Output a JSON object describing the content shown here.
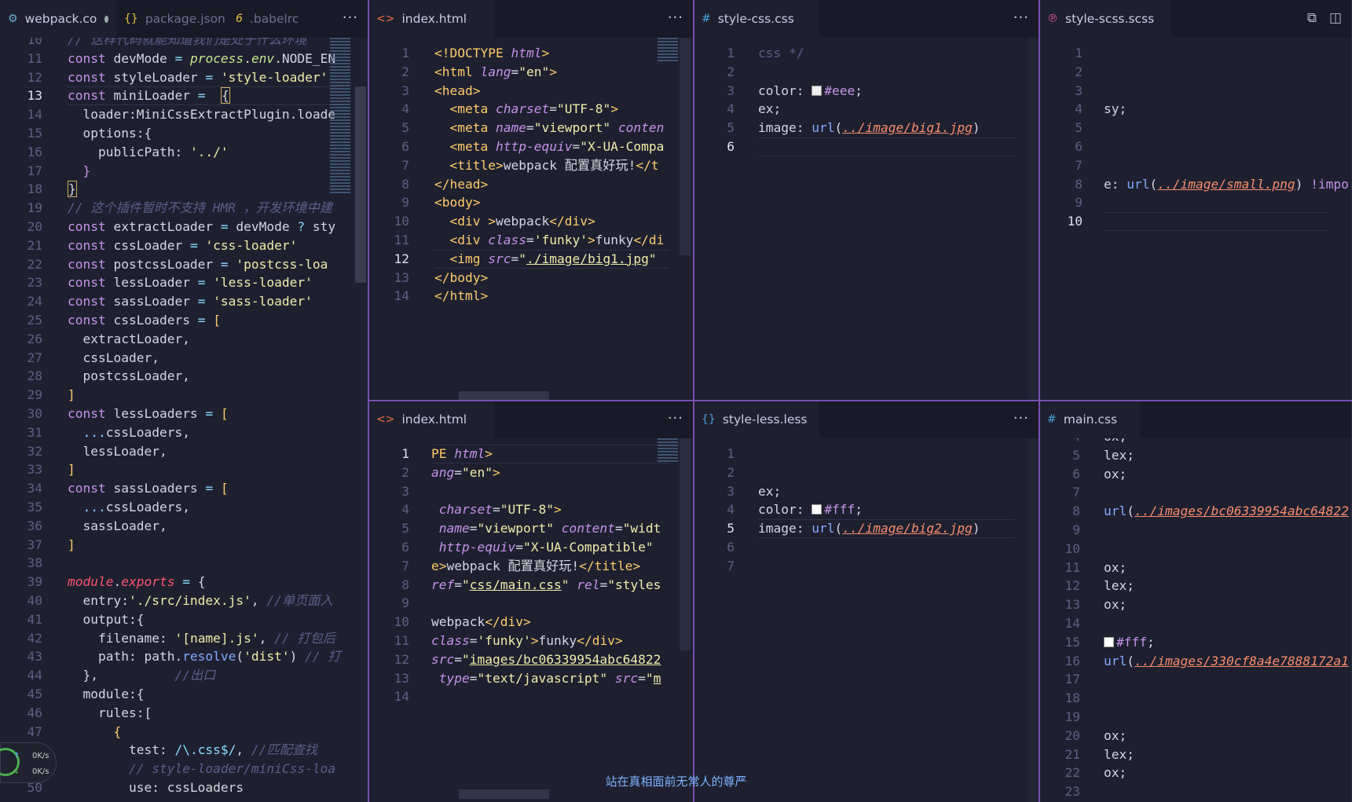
{
  "panes": {
    "webpack": {
      "tabs": [
        {
          "label": "webpack.co",
          "icon": "settings-icon",
          "active": true
        },
        {
          "label": "package.json",
          "icon": "braces-icon"
        },
        {
          "label": ".babelrc",
          "icon": "babel-icon"
        }
      ],
      "more": "···",
      "lines": [
        {
          "n": "10",
          "html": "<span class='c'>// 这样代码就能知道我们是处于什么环境</span>"
        },
        {
          "n": "11",
          "html": "<span class='k'>const</span> devMode <span class='p'>=</span> <span class='i'>process</span>.<span class='i'>env</span>.NODE_EN"
        },
        {
          "n": "12",
          "html": "<span class='k'>const</span> styleLoader <span class='p'>=</span> <span class='s'>'style-loader'</span>"
        },
        {
          "n": "13",
          "html": "<span class='k'>const</span> miniLoader <span class='p'>=</span>  <span class='bracket'>{</span>"
        },
        {
          "n": "14",
          "html": "  loader:MiniCssExtractPlugin.loade"
        },
        {
          "n": "15",
          "html": "  options:{"
        },
        {
          "n": "16",
          "html": "    publicPath: <span class='s'>'../'</span>"
        },
        {
          "n": "17",
          "html": "  <span class='k'>}</span>"
        },
        {
          "n": "18",
          "html": "<span class='bracket'>}</span>"
        },
        {
          "n": "19",
          "html": "<span class='c'>// 这个插件暂时不支持 HMR ，开发环境中建</span>"
        },
        {
          "n": "20",
          "html": "<span class='k'>const</span> extractLoader <span class='p'>=</span> devMode <span class='p'>?</span> sty"
        },
        {
          "n": "21",
          "html": "<span class='k'>const</span> cssLoader <span class='p'>=</span> <span class='s'>'css-loader'</span>"
        },
        {
          "n": "22",
          "html": "<span class='k'>const</span> postcssLoader <span class='p'>=</span> <span class='s'>'postcss-loa</span>"
        },
        {
          "n": "23",
          "html": "<span class='k'>const</span> lessLoader <span class='p'>=</span> <span class='s'>'less-loader'</span>"
        },
        {
          "n": "24",
          "html": "<span class='k'>const</span> sassLoader <span class='p'>=</span> <span class='s'>'sass-loader'</span>"
        },
        {
          "n": "25",
          "html": "<span class='k'>const</span> cssLoaders <span class='p'>=</span> <span class='t'>[</span>"
        },
        {
          "n": "26",
          "html": "  extractLoader,"
        },
        {
          "n": "27",
          "html": "  cssLoader,"
        },
        {
          "n": "28",
          "html": "  postcssLoader,"
        },
        {
          "n": "29",
          "html": "<span class='t'>]</span>"
        },
        {
          "n": "30",
          "html": "<span class='k'>const</span> lessLoaders <span class='p'>=</span> <span class='t'>[</span>"
        },
        {
          "n": "31",
          "html": "  <span class='p'>...</span>cssLoaders,"
        },
        {
          "n": "32",
          "html": "  lessLoader,"
        },
        {
          "n": "33",
          "html": "<span class='t'>]</span>"
        },
        {
          "n": "34",
          "html": "<span class='k'>const</span> sassLoaders <span class='p'>=</span> <span class='t'>[</span>"
        },
        {
          "n": "35",
          "html": "  <span class='p'>...</span>cssLoaders,"
        },
        {
          "n": "36",
          "html": "  sassLoader,"
        },
        {
          "n": "37",
          "html": "<span class='t'>]</span>"
        },
        {
          "n": "38",
          "html": ""
        },
        {
          "n": "39",
          "html": "<span class='k2'><i>module</i></span>.<span class='k2'><i>exports</i></span> <span class='p'>=</span> {"
        },
        {
          "n": "40",
          "html": "  entry:<span class='s'>'./src/index.js'</span>, <span class='c'>//单页面入</span>"
        },
        {
          "n": "41",
          "html": "  output:{"
        },
        {
          "n": "42",
          "html": "    filename: <span class='s'>'[name].js'</span>, <span class='c'>// 打包后</span>"
        },
        {
          "n": "43",
          "html": "    path: path.<span class='n'>resolve</span>(<span class='s'>'dist'</span>) <span class='c'>// 打</span>"
        },
        {
          "n": "44",
          "html": "  },          <span class='c'>//出口</span>"
        },
        {
          "n": "45",
          "html": "  module:{"
        },
        {
          "n": "46",
          "html": "    rules:["
        },
        {
          "n": "47",
          "html": "      <span class='t'>{</span>"
        },
        {
          "n": "48",
          "html": "        test: <span class='p'>/\\.css$/</span>, <span class='c'>//匹配查找</span>"
        },
        {
          "n": "49",
          "html": "        <span class='c'>// style-loader/miniCss-loa</span>"
        },
        {
          "n": "50",
          "html": "        use: cssLoaders"
        }
      ],
      "current_line": "13"
    },
    "index_top": {
      "tab": {
        "label": "index.html",
        "icon": "html-icon"
      },
      "more": "···",
      "lines": [
        {
          "n": "1",
          "html": "<span class='t'>&lt;!DOCTYPE</span> <span class='a'>html</span><span class='t'>&gt;</span>"
        },
        {
          "n": "2",
          "html": "<span class='t'>&lt;html</span> <span class='a'>lang</span>=<span class='s'>\"en\"</span><span class='t'>&gt;</span>"
        },
        {
          "n": "3",
          "html": "<span class='t'>&lt;head&gt;</span>"
        },
        {
          "n": "4",
          "html": "  <span class='t'>&lt;meta</span> <span class='a'>charset</span>=<span class='s'>\"UTF-8\"</span><span class='t'>&gt;</span>"
        },
        {
          "n": "5",
          "html": "  <span class='t'>&lt;meta</span> <span class='a'>name</span>=<span class='s'>\"viewport\"</span> <span class='a'>conten</span>"
        },
        {
          "n": "6",
          "html": "  <span class='t'>&lt;meta</span> <span class='a'>http-equiv</span>=<span class='s'>\"X-UA-Compa</span>"
        },
        {
          "n": "7",
          "html": "  <span class='t'>&lt;title&gt;</span>webpack 配置真好玩!<span class='t'>&lt;/t</span>"
        },
        {
          "n": "8",
          "html": "<span class='t'>&lt;/head&gt;</span>"
        },
        {
          "n": "9",
          "html": "<span class='t'>&lt;body&gt;</span>"
        },
        {
          "n": "10",
          "html": "  <span class='t'>&lt;div</span> <span class='t'>&gt;</span>webpack<span class='t'>&lt;/div&gt;</span>"
        },
        {
          "n": "11",
          "html": "  <span class='t'>&lt;div</span> <span class='a'>class</span>=<span class='s'>'funky'</span><span class='t'>&gt;</span>funky<span class='t'>&lt;/di</span>"
        },
        {
          "n": "12",
          "html": "  <span class='t'>&lt;img</span> <span class='a'>src</span>=<span class='s'>\"<u>./image/big1.jpg</u>\"</span>"
        },
        {
          "n": "13",
          "html": "<span class='t'>&lt;/body&gt;</span>"
        },
        {
          "n": "14",
          "html": "<span class='t'>&lt;/html&gt;</span>"
        }
      ],
      "current_line": "12"
    },
    "index_bottom": {
      "tab": {
        "label": "index.html",
        "icon": "html-icon"
      },
      "more": "···",
      "lines": [
        {
          "n": "1",
          "html": "<span class='t'>PE</span> <span class='a'>html</span><span class='t'>&gt;</span>"
        },
        {
          "n": "2",
          "html": "<span class='a'>ang</span>=<span class='s'>\"en\"</span><span class='t'>&gt;</span>"
        },
        {
          "n": "3",
          "html": ""
        },
        {
          "n": "4",
          "html": " <span class='a'>charset</span>=<span class='s'>\"UTF-8\"</span><span class='t'>&gt;</span>"
        },
        {
          "n": "5",
          "html": " <span class='a'>name</span>=<span class='s'>\"viewport\"</span> <span class='a'>content</span>=<span class='s'>\"widt</span>"
        },
        {
          "n": "6",
          "html": " <span class='a'>http-equiv</span>=<span class='s'>\"X-UA-Compatible\"</span>"
        },
        {
          "n": "7",
          "html": "<span class='t'>e&gt;</span>webpack 配置真好玩!<span class='t'>&lt;/title&gt;</span>"
        },
        {
          "n": "8",
          "html": "<span class='a'>ref</span>=<span class='s'>\"<u>css/main.css</u>\"</span> <span class='a'>rel</span>=<span class='s'>\"styles</span>"
        },
        {
          "n": "9",
          "html": ""
        },
        {
          "n": "10",
          "html": "webpack<span class='t'>&lt;/div&gt;</span>"
        },
        {
          "n": "11",
          "html": "<span class='a'>class</span>=<span class='s'>'funky'</span><span class='t'>&gt;</span>funky<span class='t'>&lt;/div&gt;</span>"
        },
        {
          "n": "12",
          "html": "<span class='a'>src</span>=<span class='s'>\"<u>images/bc06339954abc64822</u></span>"
        },
        {
          "n": "13",
          "html": " <span class='a'>type</span>=<span class='s'>\"text/javascript\"</span> <span class='a'>src</span>=<span class='s'>\"<u>m</u></span>"
        },
        {
          "n": "14",
          "html": ""
        }
      ],
      "current_line": "1"
    },
    "style_css": {
      "tab": {
        "label": "style-css.css",
        "icon": "hash-icon"
      },
      "more": "···",
      "lines": [
        {
          "n": "1",
          "html": "<span class='c' style='font-style:normal'>css */</span>"
        },
        {
          "n": "2",
          "html": ""
        },
        {
          "n": "3",
          "html": "color: <span class='swatch eee'></span><span class='k'>#eee</span>;"
        },
        {
          "n": "4",
          "html": "ex;"
        },
        {
          "n": "5",
          "html": "image: <span class='n'>url</span>(<span class='u'>../image/big1.jpg</span>)"
        },
        {
          "n": "6",
          "html": ""
        }
      ],
      "current_line": "6"
    },
    "style_less": {
      "tab": {
        "label": "style-less.less",
        "icon": "braces-icon"
      },
      "more": "···",
      "lines": [
        {
          "n": "1",
          "html": ""
        },
        {
          "n": "2",
          "html": ""
        },
        {
          "n": "3",
          "html": "ex;"
        },
        {
          "n": "4",
          "html": "color: <span class='swatch'></span><span class='k'>#fff</span>;"
        },
        {
          "n": "5",
          "html": "image: <span class='n'>url</span>(<span class='u'>../image/big2.jpg</span>)"
        },
        {
          "n": "6",
          "html": ""
        },
        {
          "n": "7",
          "html": ""
        }
      ],
      "current_line": "5"
    },
    "style_scss": {
      "tab": {
        "label": "style-scss.scss",
        "icon": "sass-icon"
      },
      "lines": [
        {
          "n": "1",
          "html": ""
        },
        {
          "n": "2",
          "html": ""
        },
        {
          "n": "3",
          "html": ""
        },
        {
          "n": "4",
          "html": "sy;"
        },
        {
          "n": "5",
          "html": ""
        },
        {
          "n": "6",
          "html": ""
        },
        {
          "n": "7",
          "html": ""
        },
        {
          "n": "8",
          "html": "e: <span class='n'>url</span>(<span class='u'>../image/small.png</span>) <span class='k'>!impo</span>"
        },
        {
          "n": "9",
          "html": ""
        },
        {
          "n": "10",
          "html": ""
        }
      ],
      "current_line": "10"
    },
    "main_css": {
      "tab": {
        "label": "main.css",
        "icon": "hash-icon"
      },
      "lines": [
        {
          "n": "4",
          "html": "ox;"
        },
        {
          "n": "5",
          "html": "lex;"
        },
        {
          "n": "6",
          "html": "ox;"
        },
        {
          "n": "7",
          "html": ""
        },
        {
          "n": "8",
          "html": "<span class='n'>url</span>(<span class='u'>../images/bc06339954abc64822</span>"
        },
        {
          "n": "9",
          "html": ""
        },
        {
          "n": "10",
          "html": ""
        },
        {
          "n": "11",
          "html": "ox;"
        },
        {
          "n": "12",
          "html": "lex;"
        },
        {
          "n": "13",
          "html": "ox;"
        },
        {
          "n": "14",
          "html": ""
        },
        {
          "n": "15",
          "html": "<span class='swatch'></span><span class='k'>#fff</span>;"
        },
        {
          "n": "16",
          "html": "<span class='n'>url</span>(<span class='u'>../images/330cf8a4e7888172a1</span>"
        },
        {
          "n": "17",
          "html": ""
        },
        {
          "n": "18",
          "html": ""
        },
        {
          "n": "19",
          "html": ""
        },
        {
          "n": "20",
          "html": "ox;"
        },
        {
          "n": "21",
          "html": "lex;"
        },
        {
          "n": "22",
          "html": "ox;"
        },
        {
          "n": "23",
          "html": ""
        }
      ],
      "current_line": ""
    }
  },
  "toolbar_icons": [
    "open-changes-icon",
    "split-editor-icon"
  ],
  "network": {
    "up": "0K/s",
    "down": "0K/s"
  },
  "caption": "站在真相面前无常人的尊严"
}
